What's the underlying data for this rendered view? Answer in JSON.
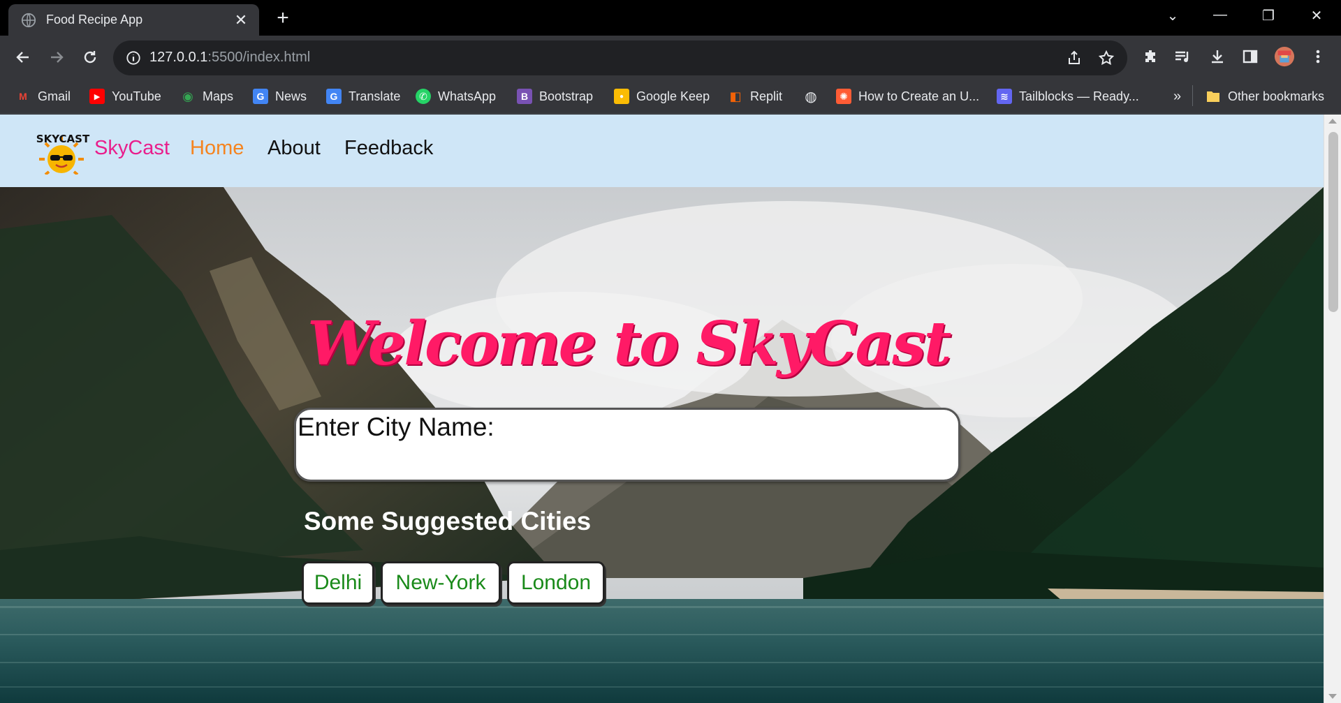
{
  "browser": {
    "tab_title": "Food Recipe App",
    "tab_close": "✕",
    "new_tab": "+",
    "url_host": "127.0.0.1",
    "url_rest": ":5500/index.html",
    "window_controls": {
      "list": "⌄",
      "minimize": "—",
      "restore": "❐",
      "close": "✕"
    }
  },
  "bookmarks": [
    {
      "label": "Gmail",
      "icon": "gmail-icon",
      "color": "#ea4335",
      "glyph": "M"
    },
    {
      "label": "YouTube",
      "icon": "youtube-icon",
      "color": "#ff0000",
      "glyph": "▶"
    },
    {
      "label": "Maps",
      "icon": "maps-icon",
      "color": "#34a853",
      "glyph": "◉"
    },
    {
      "label": "News",
      "icon": "news-icon",
      "color": "#4285f4",
      "glyph": "G"
    },
    {
      "label": "Translate",
      "icon": "translate-icon",
      "color": "#4285f4",
      "glyph": "G"
    },
    {
      "label": "WhatsApp",
      "icon": "whatsapp-icon",
      "color": "#25d366",
      "glyph": "✆"
    },
    {
      "label": "Bootstrap",
      "icon": "bootstrap-icon",
      "color": "#7952b3",
      "glyph": "B"
    },
    {
      "label": "Google Keep",
      "icon": "keep-icon",
      "color": "#fbbc04",
      "glyph": "●"
    },
    {
      "label": "Replit",
      "icon": "replit-icon",
      "color": "#f26207",
      "glyph": "◧"
    },
    {
      "label": "",
      "icon": "globe-icon",
      "color": "#9aa0a6",
      "glyph": "◍"
    },
    {
      "label": "How to Create an U...",
      "icon": "hubspot-icon",
      "color": "#ff5c35",
      "glyph": "✺"
    },
    {
      "label": "Tailblocks — Ready...",
      "icon": "tailblocks-icon",
      "color": "#6366f1",
      "glyph": "≋"
    }
  ],
  "bookmarks_overflow": "»",
  "other_bookmarks": "Other bookmarks",
  "site": {
    "brand": "SkyCast",
    "logo_text": "SKYCAST",
    "nav": {
      "home": "Home",
      "about": "About",
      "feedback": "Feedback"
    },
    "welcome": "Welcome to SkyCast",
    "city_label": "Enter City Name:",
    "suggest_title": "Some Suggested Cities",
    "cities": [
      "Delhi",
      "New-York",
      "London"
    ],
    "colors": {
      "brand": "#e91e8c",
      "active_nav": "#f5841f",
      "welcome": "#ff1a66",
      "city_chip_text": "#1a8a1a",
      "nav_bg": "#cfe6f7"
    }
  }
}
